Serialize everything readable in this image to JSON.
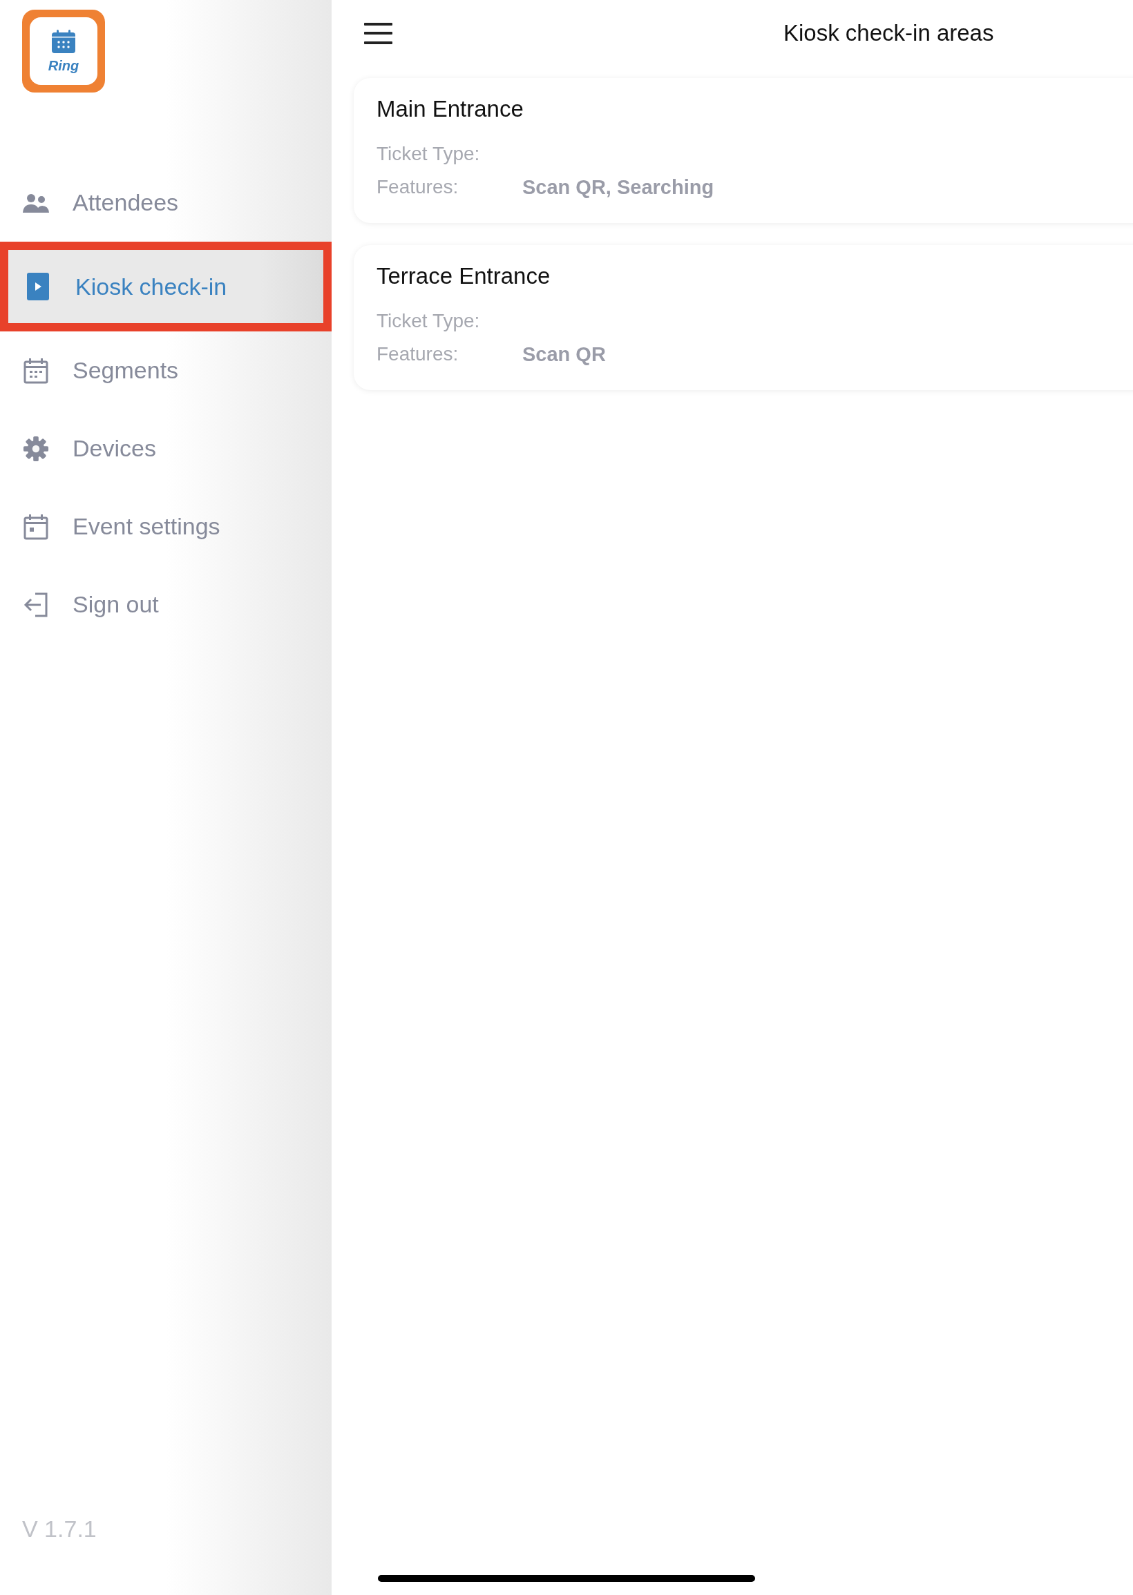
{
  "app": {
    "logo_text": "Ring"
  },
  "sidebar": {
    "items": [
      {
        "label": "Attendees",
        "kind": "people",
        "selected": false,
        "highlighted": false
      },
      {
        "label": "Kiosk check-in",
        "kind": "play",
        "selected": true,
        "highlighted": true
      },
      {
        "label": "Segments",
        "kind": "calendar-grid",
        "selected": false,
        "highlighted": false
      },
      {
        "label": "Devices",
        "kind": "gear",
        "selected": false,
        "highlighted": false
      },
      {
        "label": "Event settings",
        "kind": "calendar-day",
        "selected": false,
        "highlighted": false
      },
      {
        "label": "Sign out",
        "kind": "sign-out",
        "selected": false,
        "highlighted": false
      }
    ],
    "version": "V 1.7.1"
  },
  "header": {
    "title": "Kiosk check-in areas"
  },
  "areas": [
    {
      "name": "Main Entrance",
      "fields": [
        {
          "label": "Ticket Type:"
        },
        {
          "label": "Features:",
          "value": "Scan QR, Searching"
        }
      ]
    },
    {
      "name": "Terrace Entrance",
      "fields": [
        {
          "label": "Ticket Type:"
        },
        {
          "label": "Features:",
          "value": "Scan QR"
        }
      ]
    }
  ]
}
